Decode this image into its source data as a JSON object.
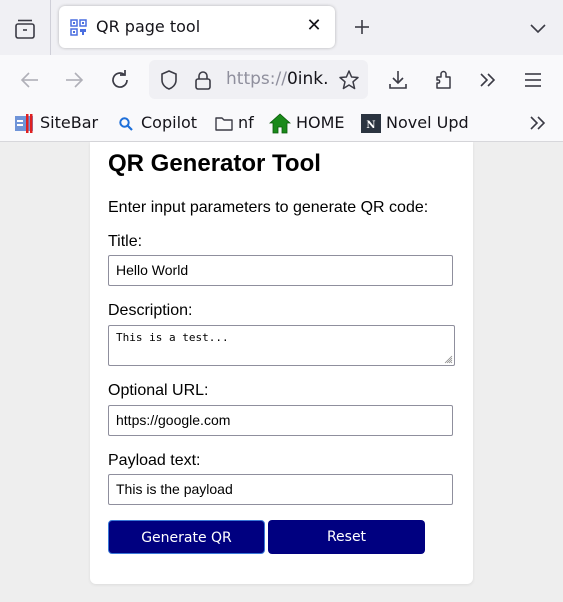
{
  "browser": {
    "tab": {
      "title": "QR page tool",
      "favicon": "qr-code-icon"
    },
    "url": {
      "prefix": "https://",
      "host": "0ink."
    },
    "bookmarks": [
      {
        "label": "SiteBar",
        "icon": "sitebar-icon"
      },
      {
        "label": "Copilot",
        "icon": "search-icon"
      },
      {
        "label": "nf",
        "icon": "folder-icon"
      },
      {
        "label": "HOME",
        "icon": "home-icon"
      },
      {
        "label": "Novel Upd",
        "icon": "novel-updates-icon"
      }
    ]
  },
  "page": {
    "title": "QR Generator Tool",
    "intro": "Enter input parameters to generate QR code:",
    "fields": {
      "title": {
        "label": "Title:",
        "value": "Hello World"
      },
      "description": {
        "label": "Description:",
        "value": "This is a test..."
      },
      "url": {
        "label": "Optional URL:",
        "value": "https://google.com"
      },
      "payload": {
        "label": "Payload text:",
        "value": "This is the payload"
      }
    },
    "buttons": {
      "generate": "Generate QR",
      "reset": "Reset"
    },
    "colors": {
      "button_bg": "#000080",
      "button_text": "#ffffff"
    }
  }
}
